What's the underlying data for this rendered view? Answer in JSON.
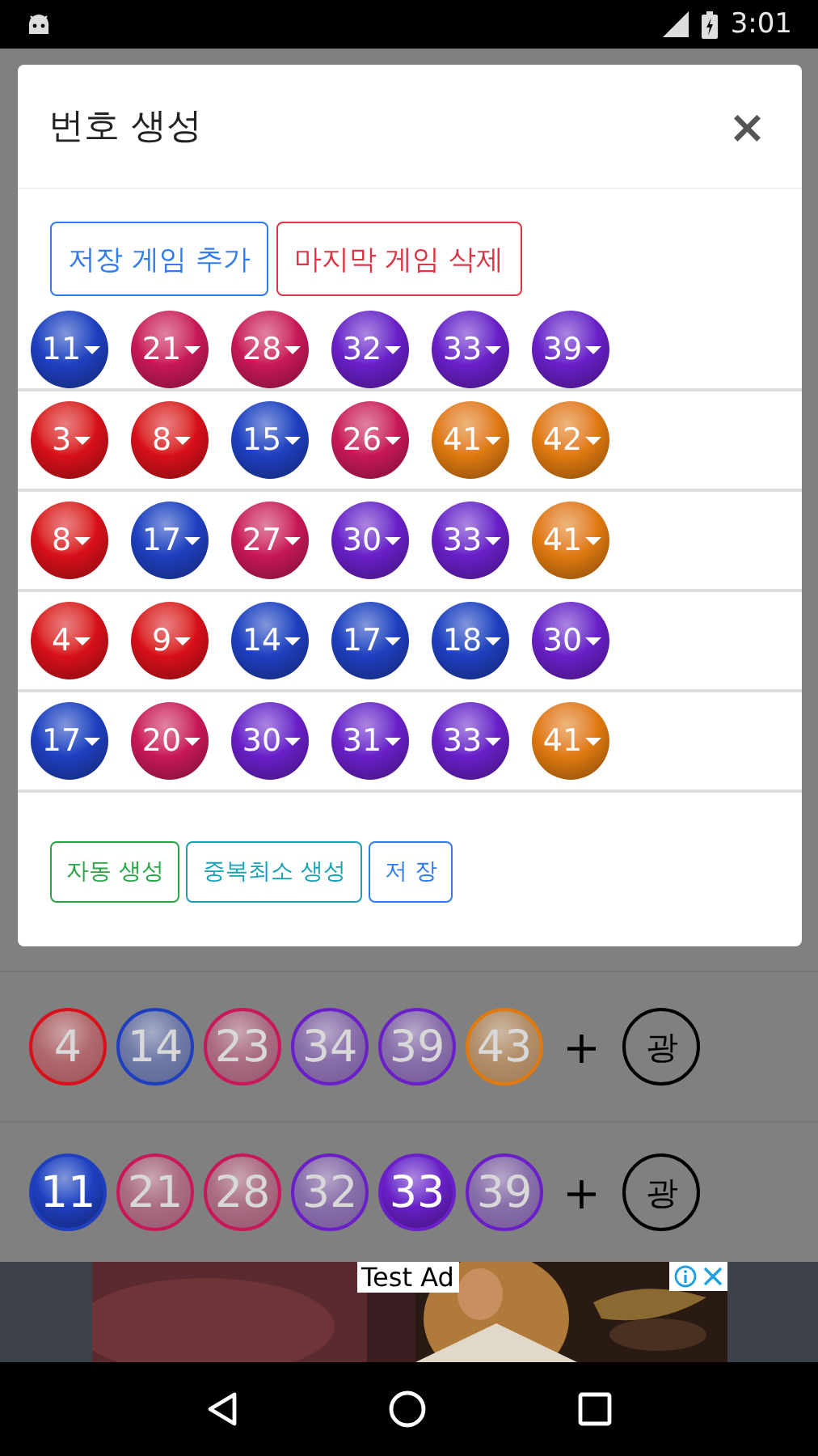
{
  "status_bar": {
    "time": "3:01"
  },
  "background_rows": [
    {
      "balls": [
        {
          "number": "4",
          "color": "#d8101a",
          "dimmed": true
        },
        {
          "number": "14",
          "color": "#1f3fbf",
          "dimmed": true
        },
        {
          "number": "23",
          "color": "#c8185a",
          "dimmed": true
        },
        {
          "number": "34",
          "color": "#6a1fc8",
          "dimmed": true
        },
        {
          "number": "39",
          "color": "#6a1fc8",
          "dimmed": true
        },
        {
          "number": "43",
          "color": "#e07a10",
          "dimmed": true
        }
      ],
      "plus": "+",
      "bonus": "광"
    },
    {
      "balls": [
        {
          "number": "11",
          "color": "#1f3fbf",
          "dimmed": false
        },
        {
          "number": "21",
          "color": "#c8185a",
          "dimmed": true
        },
        {
          "number": "28",
          "color": "#c8185a",
          "dimmed": true
        },
        {
          "number": "32",
          "color": "#6a1fc8",
          "dimmed": true
        },
        {
          "number": "33",
          "color": "#6a1fc8",
          "dimmed": false
        },
        {
          "number": "39",
          "color": "#6a1fc8",
          "dimmed": true
        }
      ],
      "plus": "+",
      "bonus": "광"
    }
  ],
  "dialog": {
    "title": "번호 생성",
    "close": "×",
    "top_buttons": [
      {
        "label": "저장 게임 추가",
        "color": "#2f7bf5"
      },
      {
        "label": "마지막 게임 삭제",
        "color": "#dc3545"
      }
    ],
    "games": [
      {
        "balls": [
          {
            "number": "11",
            "color": "#1f3fbf"
          },
          {
            "number": "21",
            "color": "#c8185a"
          },
          {
            "number": "28",
            "color": "#c8185a"
          },
          {
            "number": "32",
            "color": "#6a1fc8"
          },
          {
            "number": "33",
            "color": "#6a1fc8"
          },
          {
            "number": "39",
            "color": "#6a1fc8"
          }
        ]
      },
      {
        "balls": [
          {
            "number": "3",
            "color": "#d8101a"
          },
          {
            "number": "8",
            "color": "#d8101a"
          },
          {
            "number": "15",
            "color": "#1f3fbf"
          },
          {
            "number": "26",
            "color": "#c8185a"
          },
          {
            "number": "41",
            "color": "#e07a10"
          },
          {
            "number": "42",
            "color": "#e07a10"
          }
        ]
      },
      {
        "balls": [
          {
            "number": "8",
            "color": "#d8101a"
          },
          {
            "number": "17",
            "color": "#1f3fbf"
          },
          {
            "number": "27",
            "color": "#c8185a"
          },
          {
            "number": "30",
            "color": "#6a1fc8"
          },
          {
            "number": "33",
            "color": "#6a1fc8"
          },
          {
            "number": "41",
            "color": "#e07a10"
          }
        ]
      },
      {
        "balls": [
          {
            "number": "4",
            "color": "#d8101a"
          },
          {
            "number": "9",
            "color": "#d8101a"
          },
          {
            "number": "14",
            "color": "#1f3fbf"
          },
          {
            "number": "17",
            "color": "#1f3fbf"
          },
          {
            "number": "18",
            "color": "#1f3fbf"
          },
          {
            "number": "30",
            "color": "#6a1fc8"
          }
        ]
      },
      {
        "balls": [
          {
            "number": "17",
            "color": "#1f3fbf"
          },
          {
            "number": "20",
            "color": "#c8185a"
          },
          {
            "number": "30",
            "color": "#6a1fc8"
          },
          {
            "number": "31",
            "color": "#6a1fc8"
          },
          {
            "number": "33",
            "color": "#6a1fc8"
          },
          {
            "number": "41",
            "color": "#e07a10"
          }
        ]
      }
    ],
    "footer_buttons": [
      {
        "label": "자동 생성",
        "color": "#28a745"
      },
      {
        "label": "중복최소 생성",
        "color": "#17a2b8"
      },
      {
        "label": "저 장",
        "color": "#2f7bf5"
      }
    ]
  },
  "ad": {
    "label": "Test Ad"
  }
}
